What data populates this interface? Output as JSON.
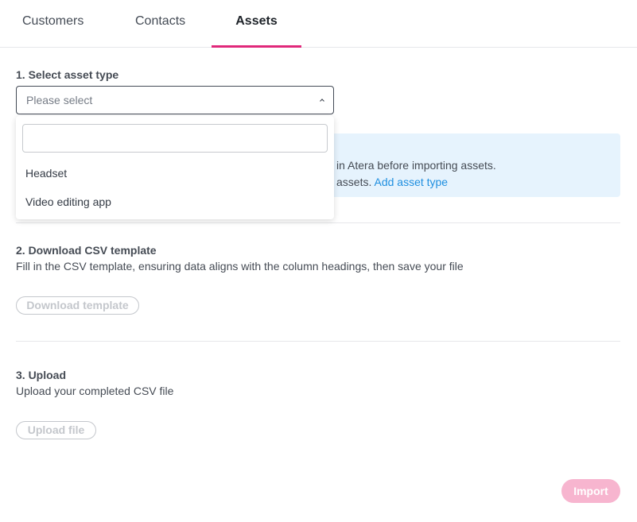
{
  "tabs": [
    {
      "label": "Customers"
    },
    {
      "label": "Contacts"
    },
    {
      "label": "Assets",
      "active": true
    }
  ],
  "step1": {
    "title": "1. Select asset type",
    "select_placeholder": "Please select",
    "dropdown": {
      "search_value": "",
      "options": [
        "Headset",
        "Video editing app"
      ]
    },
    "info": {
      "line1": "in Atera before importing assets.",
      "line2_text": "assets.",
      "link": "Add asset type"
    }
  },
  "step2": {
    "title": "2. Download CSV template",
    "description": "Fill in the CSV template, ensuring data aligns with the column headings, then save your file",
    "button": "Download template"
  },
  "step3": {
    "title": "3. Upload",
    "description": "Upload your completed CSV file",
    "button": "Upload file"
  },
  "footer": {
    "import_button": "Import"
  },
  "colors": {
    "accent": "#e0287a",
    "import_disabled": "#f7b5cf",
    "link": "#1f8fe0",
    "info_bg": "#e6f3fd"
  }
}
